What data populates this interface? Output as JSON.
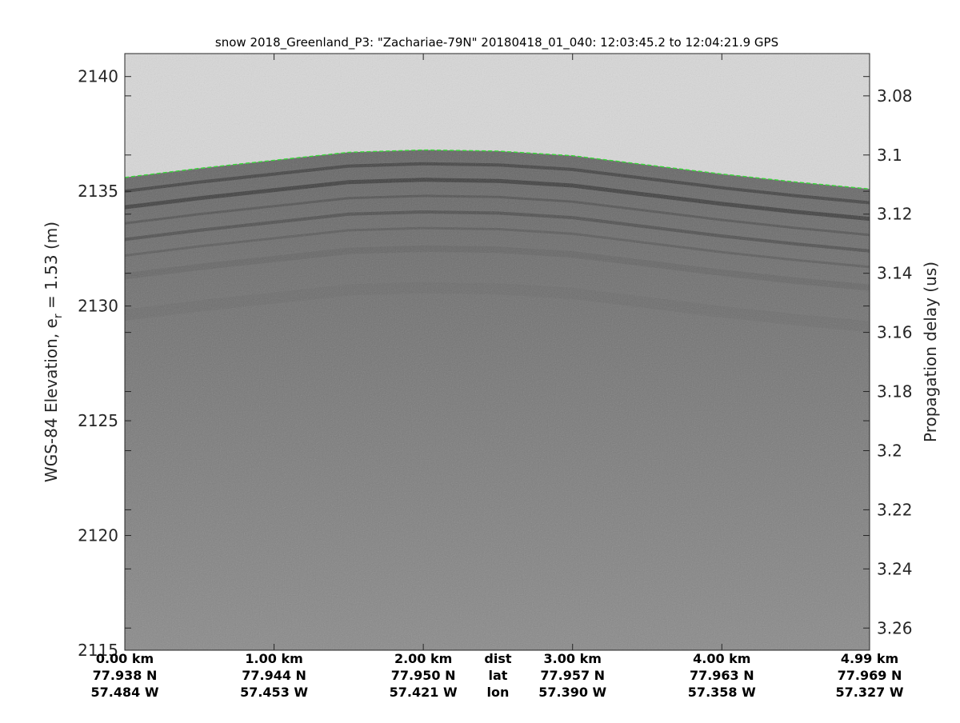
{
  "chart_data": {
    "type": "heatmap",
    "title": "snow 2018_Greenland_P3: \"Zachariae-79N\"  20180418_01_040: 12:03:45.2 to 12:04:21.9 GPS",
    "ylabel_left_main": "WGS-84 Elevation, e",
    "ylabel_left_sub": "r",
    "ylabel_left_rest": " = 1.53 (m)",
    "ylabel_right": "Propagation delay (us)",
    "ylim_left": [
      2115,
      2141
    ],
    "yticks_left": [
      2115,
      2120,
      2125,
      2130,
      2135,
      2140
    ],
    "ylim_right": [
      3.0657,
      3.2675
    ],
    "yticks_right": [
      "3.08",
      "3.1",
      "3.12",
      "3.14",
      "3.16",
      "3.18",
      "3.2",
      "3.22",
      "3.24",
      "3.26"
    ],
    "x_distance_km": [
      0.0,
      1.0,
      2.0,
      3.0,
      4.0,
      4.99
    ],
    "xtick_rows": [
      [
        "0.00 km",
        "1.00 km",
        "2.00 km",
        "3.00 km",
        "4.00 km",
        "4.99 km"
      ],
      [
        "77.938 N",
        "77.944 N",
        "77.950 N",
        "77.957 N",
        "77.963 N",
        "77.969 N"
      ],
      [
        "57.484 W",
        "57.453 W",
        "57.421 W",
        "57.390 W",
        "57.358 W",
        "57.327 W"
      ]
    ],
    "row_labels": [
      "dist",
      "lat",
      "lon"
    ],
    "surface_line_color": "#22dd22",
    "surface_profile": {
      "x_km": [
        0.0,
        0.5,
        1.0,
        1.5,
        2.0,
        2.5,
        3.0,
        3.5,
        4.0,
        4.5,
        4.99
      ],
      "elev_m": [
        2135.6,
        2136.0,
        2136.35,
        2136.7,
        2136.8,
        2136.75,
        2136.55,
        2136.15,
        2135.75,
        2135.4,
        2135.1
      ]
    },
    "grid": false,
    "colormap": "gray"
  }
}
